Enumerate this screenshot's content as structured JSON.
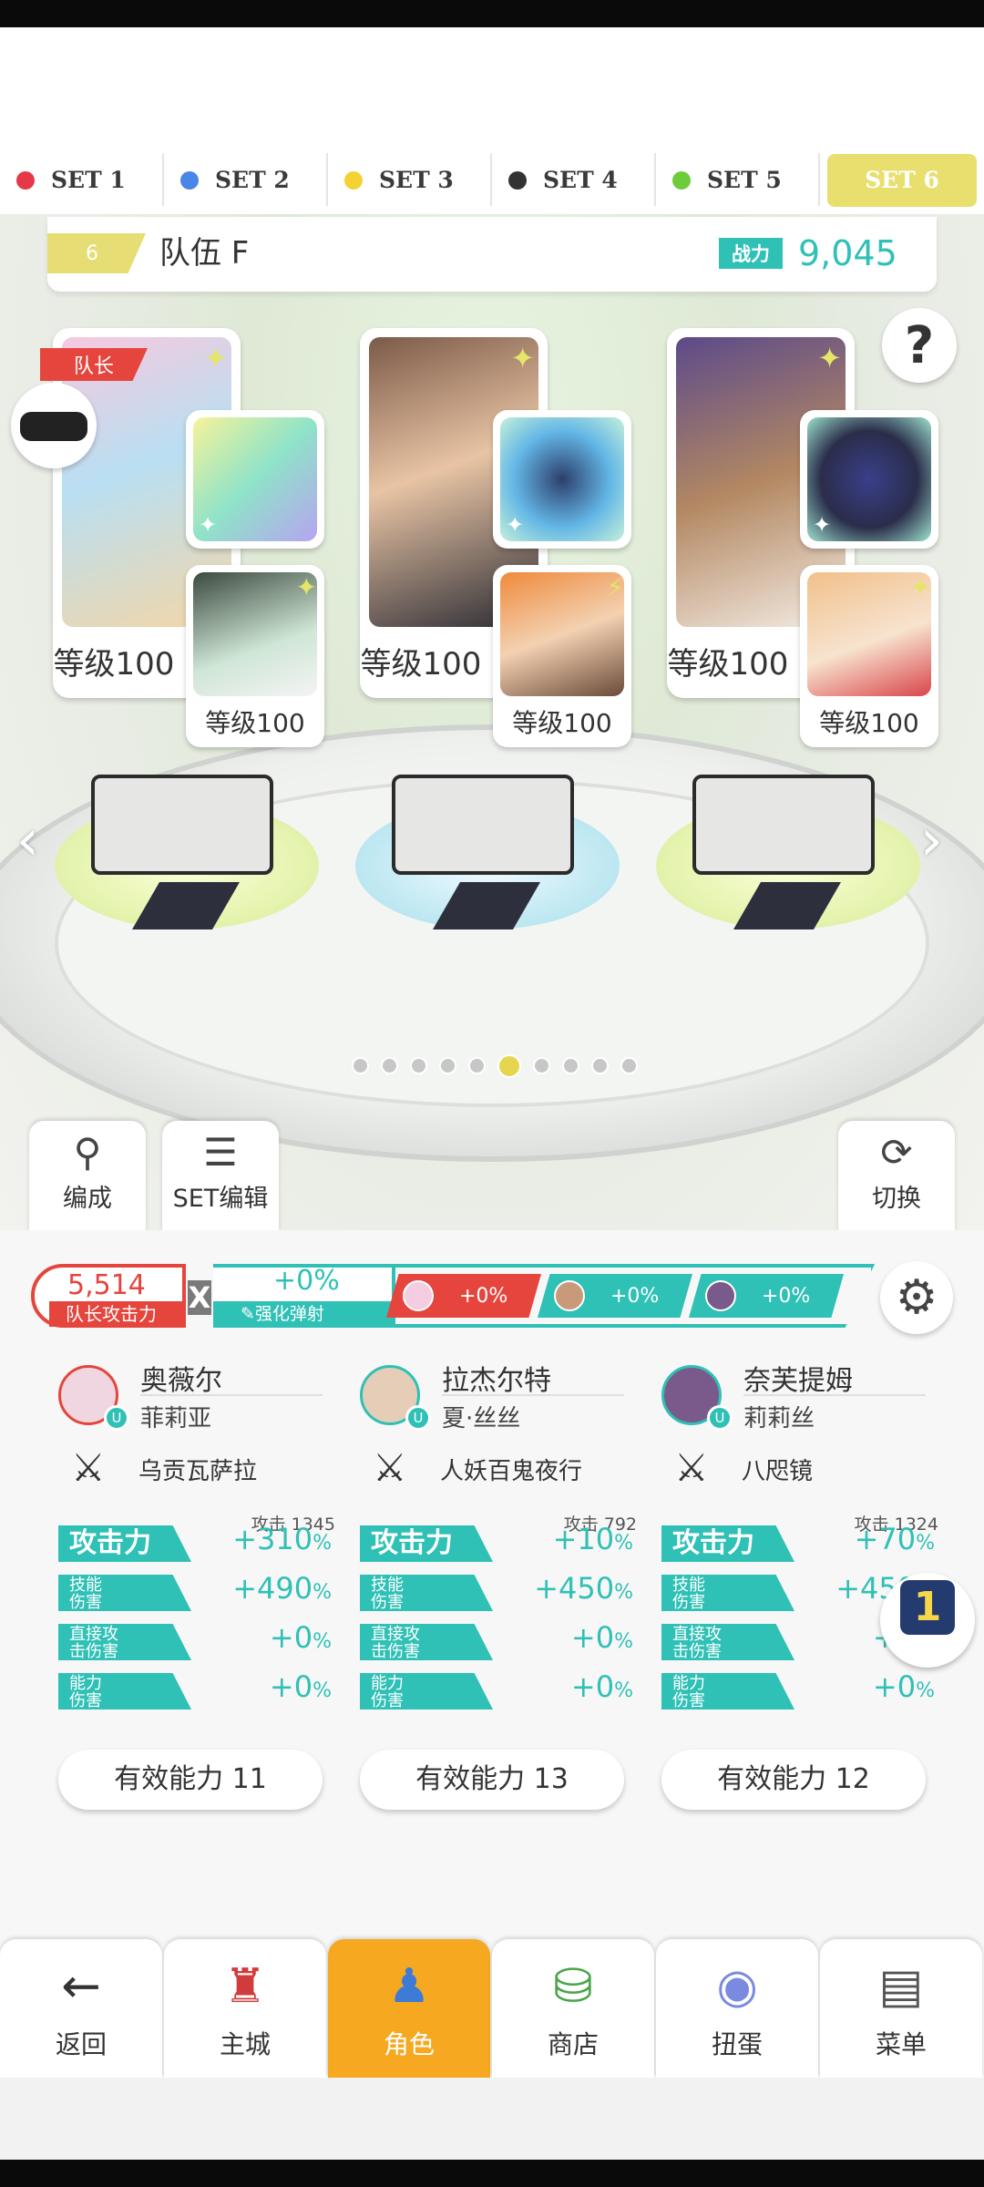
{
  "sets": [
    {
      "label": "SET 1",
      "color": "#e5394a"
    },
    {
      "label": "SET 2",
      "color": "#4a86e8"
    },
    {
      "label": "SET 3",
      "color": "#f4d234"
    },
    {
      "label": "SET 4",
      "color": "#333333"
    },
    {
      "label": "SET 5",
      "color": "#6ccc3b"
    },
    {
      "label": "SET 6",
      "color": "#e8df6e"
    }
  ],
  "team": {
    "number": "6",
    "name": "队伍 F",
    "power_label": "战力",
    "power_value": "9,045"
  },
  "captain_tag": "队长",
  "heroes": [
    {
      "level": "等级100",
      "sub_level": "等级100"
    },
    {
      "level": "等级100",
      "sub_level": "等级100"
    },
    {
      "level": "等级100",
      "sub_level": "等级100"
    }
  ],
  "page_dots": {
    "count": 10,
    "active": 6
  },
  "tools": {
    "formation": "编成",
    "set_edit": "SET编辑",
    "switch": "切换"
  },
  "stats_bar": {
    "leader_attack_value": "5,514",
    "leader_attack_label": "队长攻击力",
    "multiply": "X",
    "boost_value": "+0%",
    "boost_label": "强化弹射",
    "chips": [
      "+0%",
      "+0%",
      "+0%"
    ]
  },
  "members": [
    {
      "name": "奥薇尔",
      "sub_name": "菲莉亚",
      "weapon": "乌贡瓦萨拉",
      "attack_small": "攻击 1345",
      "stats": [
        {
          "label": "攻击力",
          "value": "+310"
        },
        {
          "label": "技能\n伤害",
          "value": "+490"
        },
        {
          "label": "直接攻\n击伤害",
          "value": "+0"
        },
        {
          "label": "能力\n伤害",
          "value": "+0"
        }
      ],
      "effective": "有效能力 11"
    },
    {
      "name": "拉杰尔特",
      "sub_name": "夏·丝丝",
      "weapon": "人妖百鬼夜行",
      "attack_small": "攻击  792",
      "stats": [
        {
          "label": "攻击力",
          "value": "+10"
        },
        {
          "label": "技能\n伤害",
          "value": "+450"
        },
        {
          "label": "直接攻\n击伤害",
          "value": "+0"
        },
        {
          "label": "能力\n伤害",
          "value": "+0"
        }
      ],
      "effective": "有效能力 13"
    },
    {
      "name": "奈芙提姆",
      "sub_name": "莉莉丝",
      "weapon": "八咫镜",
      "attack_small": "攻击 1324",
      "stats": [
        {
          "label": "攻击力",
          "value": "+70"
        },
        {
          "label": "技能\n伤害",
          "value": "+450"
        },
        {
          "label": "直接攻\n击伤害",
          "value": "+0"
        },
        {
          "label": "能力\n伤害",
          "value": "+0"
        }
      ],
      "effective": "有效能力 12"
    }
  ],
  "percent": "%",
  "rank_badge": "1",
  "nav": [
    {
      "label": "返回",
      "icon": "back-arrow-icon"
    },
    {
      "label": "主城",
      "icon": "castle-icon"
    },
    {
      "label": "角色",
      "icon": "character-icon"
    },
    {
      "label": "商店",
      "icon": "shop-icon"
    },
    {
      "label": "扭蛋",
      "icon": "gacha-icon"
    },
    {
      "label": "菜单",
      "icon": "menu-icon"
    }
  ],
  "nav_active": 2
}
